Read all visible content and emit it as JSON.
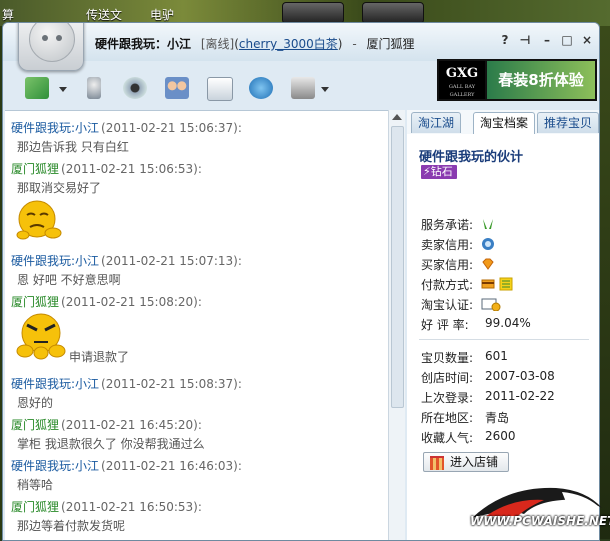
{
  "desktop": {
    "left_label": "算",
    "mid_label": "传送文",
    "right_label": "电驴"
  },
  "window": {
    "title_name": "硬件跟我玩：小江",
    "status": "[离线]",
    "contact_prefix": "(",
    "contact_handle": "cherry_3000白茶",
    "contact_suffix": ")",
    "separator": "-",
    "owner": "厦门狐狸",
    "controls": [
      "?",
      "⊣",
      "–",
      "□",
      "×"
    ]
  },
  "banner": {
    "logo": "GXG",
    "logo_sub": "GALL BAY GALLERY",
    "promo": "春装8折体验"
  },
  "toolbar": {
    "icons": [
      "file-transfer-icon",
      "microphone-icon",
      "webcam-icon",
      "group-icon",
      "message-record-icon",
      "remote-assist-icon",
      "more-tools-icon"
    ]
  },
  "chat": {
    "messages": [
      {
        "sender": "硬件跟我玩:小江",
        "time": "(2011-02-21 15:06:37):",
        "body": "那边告诉我 只有白红"
      },
      {
        "sender": "厦门狐狸",
        "time": "(2011-02-21 15:06:53):",
        "body": "那取消交易好了"
      },
      {
        "sender": "硬件跟我玩:小江",
        "time": "(2011-02-21 15:07:13):",
        "body": "恩 好吧 不好意思啊"
      },
      {
        "sender": "厦门狐狸",
        "time": "(2011-02-21 15:08:20):",
        "body": "申请退款了"
      },
      {
        "sender": "硬件跟我玩:小江",
        "time": "(2011-02-21 15:08:37):",
        "body": "恩好的"
      },
      {
        "sender": "厦门狐狸",
        "time": "(2011-02-21 16:45:20):",
        "body": "掌柜   我退款很久了      你没帮我通过么"
      },
      {
        "sender": "硬件跟我玩:小江",
        "time": "(2011-02-21 16:46:03):",
        "body": "稍等哈"
      },
      {
        "sender": "厦门狐狸",
        "time": "(2011-02-21 16:50:53):",
        "body": "那边等着付款发货呢"
      }
    ]
  },
  "panel": {
    "tabs": [
      "淘江湖",
      "淘宝档案",
      "推荐宝贝"
    ],
    "shop_name": "硬件跟我玩的伙计",
    "badge": "钻石",
    "labels": {
      "service": "服务承诺:",
      "seller_credit": "卖家信用:",
      "buyer_credit": "买家信用:",
      "payment": "付款方式:",
      "certification": "淘宝认证:",
      "rating": "好 评 率:",
      "item_count": "宝贝数量:",
      "created": "创店时间:",
      "last_login": "上次登录:",
      "location": "所在地区:",
      "popularity": "收藏人气:"
    },
    "values": {
      "rating": "99.04%",
      "item_count": "601",
      "created": "2007-03-08",
      "last_login": "2011-02-22",
      "location": "青岛",
      "popularity": "2600"
    },
    "enter_shop": "进入店铺"
  },
  "watermark": {
    "text": "WWW.PCWAISHE.NET"
  },
  "colors": {
    "buyer_sender": "#1a5aa0",
    "seller_sender": "#2a8a2a",
    "badge": "#8a3bb0"
  }
}
